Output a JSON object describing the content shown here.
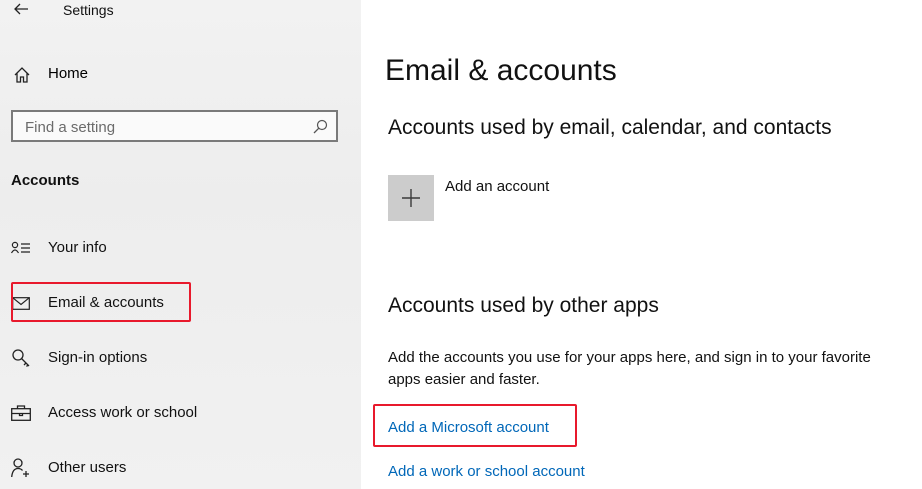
{
  "window": {
    "title": "Settings"
  },
  "sidebar": {
    "home_label": "Home",
    "search": {
      "placeholder": "Find a setting",
      "value": ""
    },
    "section_heading": "Accounts",
    "items": [
      {
        "label": "Your info",
        "icon": "contact-card-icon"
      },
      {
        "label": "Email & accounts",
        "icon": "mail-icon",
        "selected": true
      },
      {
        "label": "Sign-in options",
        "icon": "key-icon"
      },
      {
        "label": "Access work or school",
        "icon": "briefcase-icon"
      },
      {
        "label": "Other users",
        "icon": "person-add-icon"
      }
    ]
  },
  "main": {
    "title": "Email & accounts",
    "section1": {
      "heading": "Accounts used by email, calendar, and contacts",
      "add_label": "Add an account"
    },
    "section2": {
      "heading": "Accounts used by other apps",
      "description": "Add the accounts you use for your apps here, and sign in to your favorite apps easier and faster.",
      "links": [
        "Add a Microsoft account",
        "Add a work or school account"
      ]
    }
  },
  "colors": {
    "accent_link": "#0067b8",
    "highlight": "#e8192c",
    "tile": "#cccccc"
  }
}
